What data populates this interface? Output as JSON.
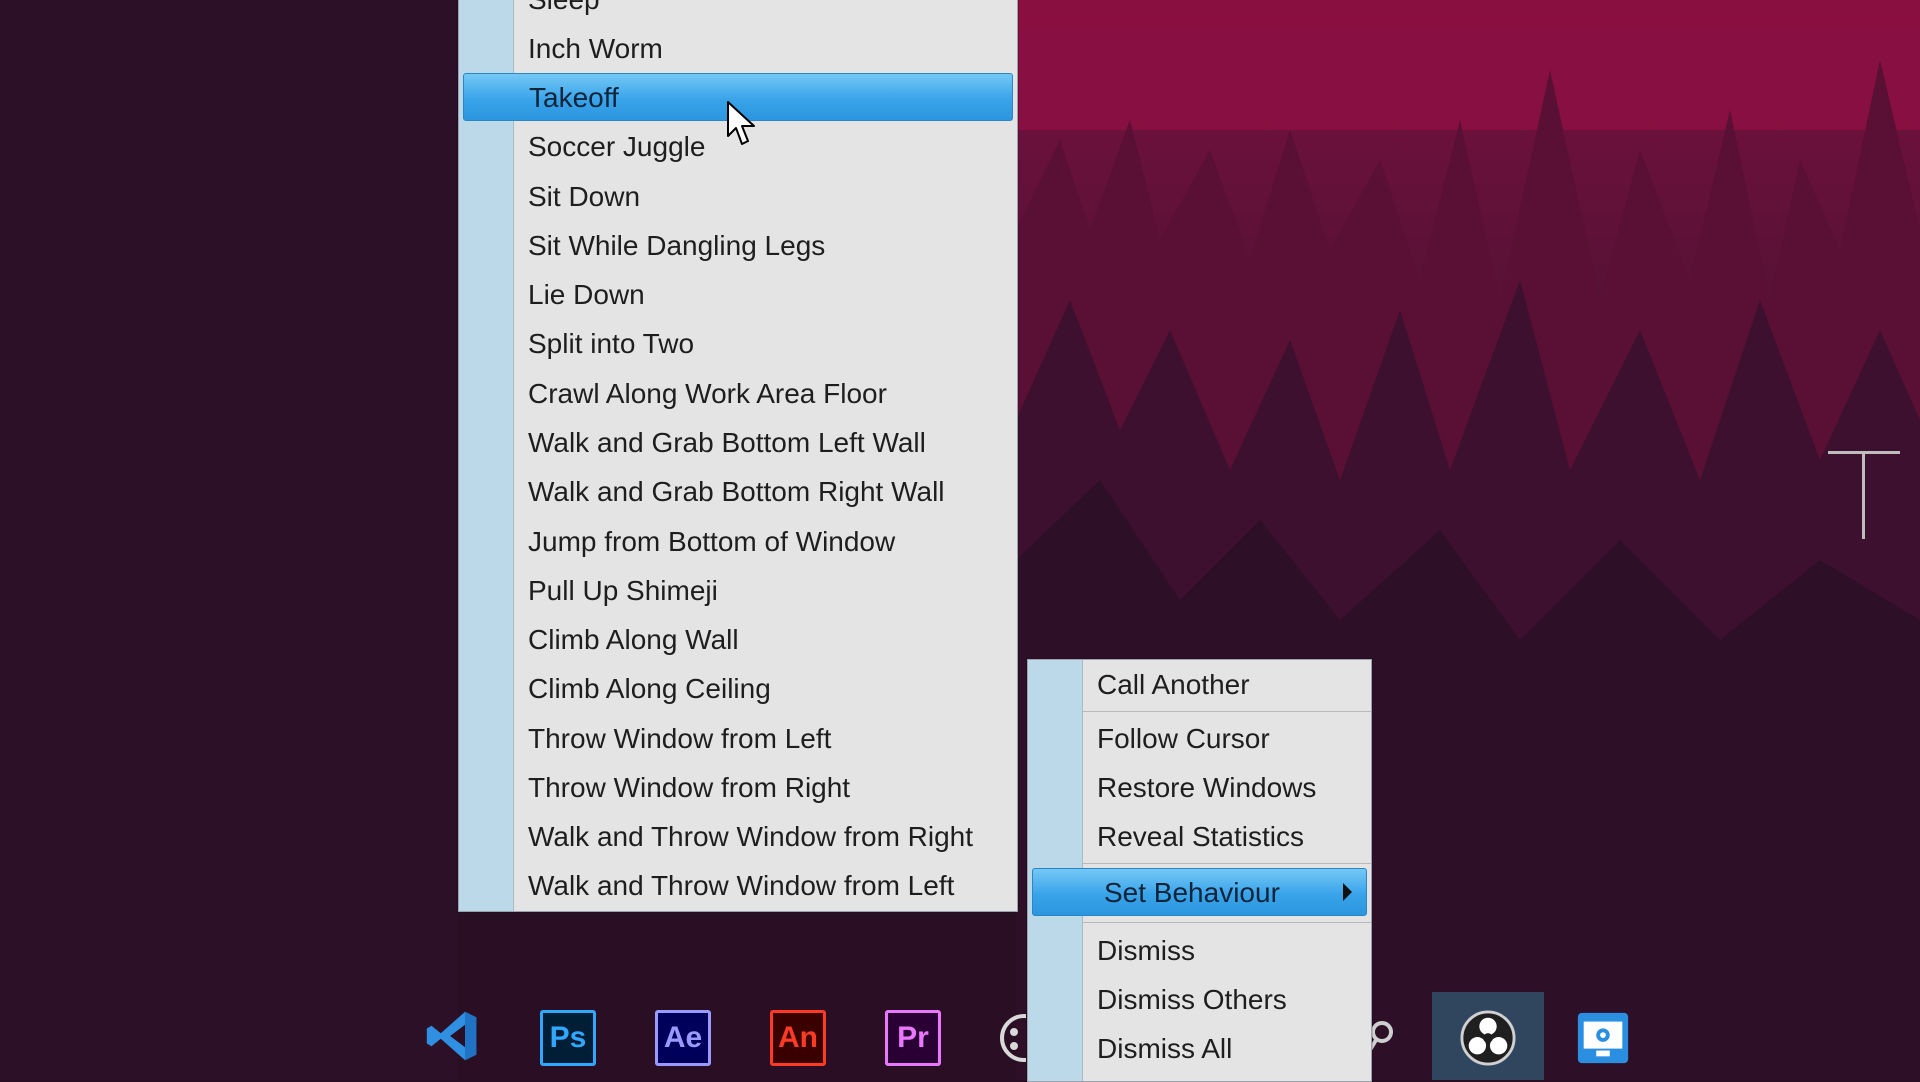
{
  "behaviour_menu": {
    "items": [
      {
        "label": "Sleep"
      },
      {
        "label": "Inch Worm"
      },
      {
        "label": "Takeoff",
        "selected": true
      },
      {
        "label": "Soccer Juggle"
      },
      {
        "label": "Sit Down"
      },
      {
        "label": "Sit While Dangling Legs"
      },
      {
        "label": "Lie Down"
      },
      {
        "label": "Split into Two"
      },
      {
        "label": "Crawl Along Work Area Floor"
      },
      {
        "label": "Walk and Grab Bottom Left Wall"
      },
      {
        "label": "Walk and Grab Bottom Right Wall"
      },
      {
        "label": "Jump from Bottom of Window"
      },
      {
        "label": "Pull Up Shimeji"
      },
      {
        "label": "Climb Along Wall"
      },
      {
        "label": "Climb Along Ceiling"
      },
      {
        "label": "Throw Window from Left"
      },
      {
        "label": "Throw Window from Right"
      },
      {
        "label": "Walk and Throw Window from Right"
      },
      {
        "label": "Walk and Throw Window from Left"
      }
    ]
  },
  "context_menu": {
    "call_another": "Call Another",
    "follow_cursor": "Follow Cursor",
    "restore_windows": "Restore Windows",
    "reveal_statistics": "Reveal Statistics",
    "set_behaviour": "Set Behaviour",
    "dismiss": "Dismiss",
    "dismiss_others": "Dismiss Others",
    "dismiss_all": "Dismiss All"
  },
  "taskbar": {
    "icons": [
      {
        "name": "vscode-icon"
      },
      {
        "name": "photoshop-icon",
        "text": "Ps",
        "color": "#31a8ff",
        "bg": "#001e36"
      },
      {
        "name": "after-effects-icon",
        "text": "Ae",
        "color": "#9999ff",
        "bg": "#00005b"
      },
      {
        "name": "animate-icon",
        "text": "An",
        "color": "#ff3a26",
        "bg": "#3a0000"
      },
      {
        "name": "premiere-icon",
        "text": "Pr",
        "color": "#ea77ff",
        "bg": "#2a0034"
      },
      {
        "name": "obs-icon"
      },
      {
        "name": "display-settings-icon"
      }
    ]
  },
  "colors": {
    "menu_bg": "#e4e4e4",
    "menu_gutter": "#bcd9ea",
    "selected_bg": "#3aa4ea",
    "desktop_sky": "#2a0f24",
    "desktop_red": "#6e0f3c"
  }
}
